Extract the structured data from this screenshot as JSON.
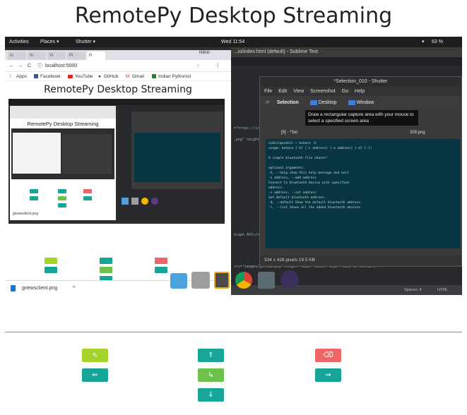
{
  "page": {
    "title": "RemotePy Desktop Streaming"
  },
  "stream": {
    "topbar": {
      "activities": "Activities",
      "places": "Places ▾",
      "shutter": "Shutter ▾",
      "clock": "Wed 11:54",
      "battery": "63 %"
    },
    "browser": {
      "tabs": [
        "In",
        "In",
        "Vi",
        "Pi",
        "R",
        "Nikhil"
      ],
      "url": "localhost:5000",
      "bookmarks": [
        "Apps",
        "Facebook",
        "YouTube",
        "GitHub",
        "Gmail",
        "Indian Pythonist"
      ],
      "inner_title": "RemotePy Desktop Streaming",
      "nested_title": "RemotePy Desktop Streaming",
      "download_file": "gnewsclient.png"
    },
    "sublime": {
      "title": "...io/index.html (default) - Sublime Text",
      "code": [
        "=\"https://ir",
        ".png\" height=",
        "Graph API</>",
        "src=\"images/github.png\" height=\"20px\" width=\"20px\">View on GitHub</>"
      ],
      "status_spaces": "Spaces: 4",
      "status_lang": "HTML"
    },
    "shutter": {
      "title": "*Selection_010 - Shutter",
      "menu": [
        "File",
        "Edit",
        "View",
        "Screenshot",
        "Go",
        "Help"
      ],
      "toolbar": [
        "Selection",
        "Desktop",
        "Window"
      ],
      "tooltip": "Draw a rectangular capture area with your mouse to select a specified screen area",
      "tab_label": "[9] - *Sel",
      "file_label": "309.png",
      "status": "534 x 428 pixels  19.5 KB",
      "terminal": [
        "nikhil@nikhil  ~  bshare -h",
        "usage: bshare [-h] [-s address] [-a address] [-d] [-l]",
        "",
        "A simple bluetooth file sharer!",
        "",
        "optional arguments:",
        "  -h, --help            show this help message and exit",
        "  -s address, --add address",
        "                        Connect to bluetooth device with specified",
        "                        address.",
        "  -s address, --set address",
        "                        Set default bluetooth address.",
        "  -d, --default         Show the default bluetooth address.",
        "  -l, --list            Shows all the added bluetooth devices"
      ]
    }
  },
  "controls": {
    "up_left": "⇖",
    "up": "⇑",
    "backspace": "⌫",
    "left": "⇐",
    "enter": "↳",
    "right": "⇒",
    "down": "⇓"
  },
  "colors": {
    "lime": "#a6d32a",
    "teal": "#17a597",
    "green": "#6cc24a",
    "red": "#f06666"
  }
}
